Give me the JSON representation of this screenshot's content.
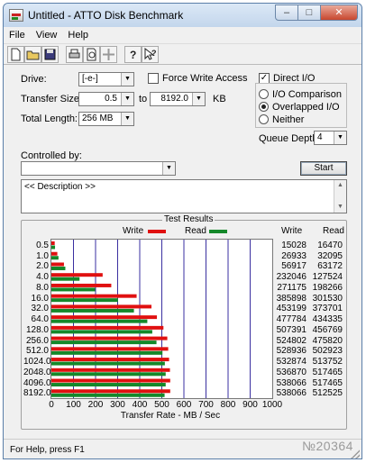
{
  "window": {
    "title": "Untitled - ATTO Disk Benchmark",
    "minimize": "–",
    "maximize": "□",
    "close": "✕"
  },
  "menu": [
    "File",
    "View",
    "Help"
  ],
  "toolbar": {
    "icons": [
      "new-icon",
      "open-icon",
      "save-icon",
      "print-icon",
      "print-preview-icon",
      "move-icon",
      "help-icon",
      "context-help-icon"
    ]
  },
  "settings": {
    "drive_label": "Drive:",
    "drive_value": "[-e-]",
    "force_write_label": "Force Write Access",
    "force_write_checked": false,
    "direct_io_label": "Direct I/O",
    "direct_io_checked": true,
    "transfer_size_label": "Transfer Size:",
    "transfer_from": "0.5",
    "transfer_to_label": "to",
    "transfer_to": "8192.0",
    "transfer_unit": "KB",
    "total_length_label": "Total Length:",
    "total_length": "256 MB",
    "io_comparison_label": "I/O Comparison",
    "overlapped_io_label": "Overlapped I/O",
    "neither_label": "Neither",
    "io_mode_selected": "Overlapped I/O",
    "queue_depth_label": "Queue Depth:",
    "queue_depth": "4",
    "controlled_by_label": "Controlled by:",
    "controlled_by_value": "",
    "start_label": "Start",
    "description": "<< Description >>"
  },
  "results": {
    "title": "Test Results",
    "write_legend": "Write",
    "read_legend": "Read",
    "write_col": "Write",
    "read_col": "Read",
    "rows": [
      {
        "size": "0.5",
        "write": "15028",
        "read": "16470"
      },
      {
        "size": "1.0",
        "write": "26933",
        "read": "32095"
      },
      {
        "size": "2.0",
        "write": "56917",
        "read": "63172"
      },
      {
        "size": "4.0",
        "write": "232046",
        "read": "127524"
      },
      {
        "size": "8.0",
        "write": "271175",
        "read": "198266"
      },
      {
        "size": "16.0",
        "write": "385898",
        "read": "301530"
      },
      {
        "size": "32.0",
        "write": "453199",
        "read": "373701"
      },
      {
        "size": "64.0",
        "write": "477784",
        "read": "434335"
      },
      {
        "size": "128.0",
        "write": "507391",
        "read": "456769"
      },
      {
        "size": "256.0",
        "write": "524802",
        "read": "475820"
      },
      {
        "size": "512.0",
        "write": "528936",
        "read": "502923"
      },
      {
        "size": "1024.0",
        "write": "532874",
        "read": "513752"
      },
      {
        "size": "2048.0",
        "write": "536870",
        "read": "517465"
      },
      {
        "size": "4096.0",
        "write": "538066",
        "read": "517465"
      },
      {
        "size": "8192.0",
        "write": "538066",
        "read": "512525"
      }
    ],
    "x_ticks": [
      "0",
      "100",
      "200",
      "300",
      "400",
      "500",
      "600",
      "700",
      "800",
      "900",
      "1000"
    ],
    "x_label": "Transfer Rate - MB / Sec"
  },
  "colors": {
    "write": "#e01010",
    "read": "#14882a",
    "grid": "#3a2fa0"
  },
  "chart_data": {
    "type": "bar",
    "orientation": "horizontal",
    "categories": [
      "0.5",
      "1.0",
      "2.0",
      "4.0",
      "8.0",
      "16.0",
      "32.0",
      "64.0",
      "128.0",
      "256.0",
      "512.0",
      "1024.0",
      "2048.0",
      "4096.0",
      "8192.0"
    ],
    "series": [
      {
        "name": "Write",
        "values": [
          15.028,
          26.933,
          56.917,
          232.046,
          271.175,
          385.898,
          453.199,
          477.784,
          507.391,
          524.802,
          528.936,
          532.874,
          536.87,
          538.066,
          538.066
        ]
      },
      {
        "name": "Read",
        "values": [
          16.47,
          32.095,
          63.172,
          127.524,
          198.266,
          301.53,
          373.701,
          434.335,
          456.769,
          475.82,
          502.923,
          513.752,
          517.465,
          517.465,
          512.525
        ]
      }
    ],
    "title": "Test Results",
    "xlabel": "Transfer Rate - MB / Sec",
    "xlim": [
      0,
      1000
    ],
    "grid": true,
    "legend": "top"
  },
  "status": {
    "text": "For Help, press F1",
    "watermark": "№20364"
  }
}
